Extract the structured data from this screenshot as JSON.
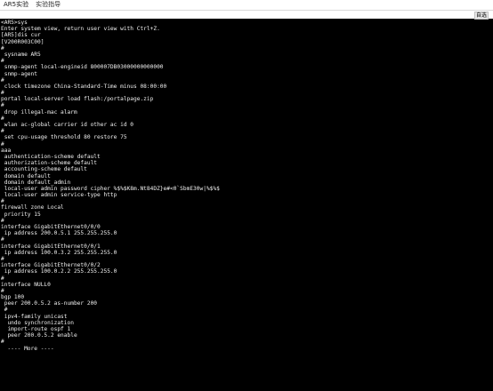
{
  "tabs": [
    {
      "label": "AR5实验"
    },
    {
      "label": "实验指导"
    }
  ],
  "toolbar": {
    "buttons_label": "自选"
  },
  "terminal": {
    "lines": [
      "<AR5>sys",
      "Enter system view, return user view with Ctrl+Z.",
      "[AR5]dis cur",
      "[V200R003C00]",
      "#",
      " sysname AR5",
      "#",
      " snmp-agent local-engineid 800007DB03000000000000",
      " snmp-agent",
      "#",
      " clock timezone China-Standard-Time minus 08:00:00",
      "#",
      "portal local-server load flash:/portalpage.zip",
      "#",
      " drop illegal-mac alarm",
      "#",
      " wlan ac-global carrier id other ac id 0",
      "#",
      " set cpu-usage threshold 80 restore 75",
      "#",
      "aaa",
      " authentication-scheme default",
      " authorization-scheme default",
      " accounting-scheme default",
      " domain default",
      " domain default_admin",
      " local-user admin password cipher %$%$K8m.Nt84DZ}e#<0`SbmE30w|%$%$",
      " local-user admin service-type http",
      "#",
      "firewall zone Local",
      " priority 15",
      "#",
      "interface GigabitEthernet0/0/0",
      " ip address 200.0.5.1 255.255.255.0",
      "#",
      "interface GigabitEthernet0/0/1",
      " ip address 100.0.3.2 255.255.255.0",
      "#",
      "interface GigabitEthernet0/0/2",
      " ip address 100.0.2.2 255.255.255.0",
      "#",
      "interface NULL0",
      "#",
      "bgp 100",
      " peer 200.0.5.2 as-number 200",
      " #",
      " ipv4-family unicast",
      "  undo synchronization",
      "  import-route ospf 1",
      "  peer 200.0.5.2 enable",
      "#",
      "  ---- More ----"
    ]
  }
}
